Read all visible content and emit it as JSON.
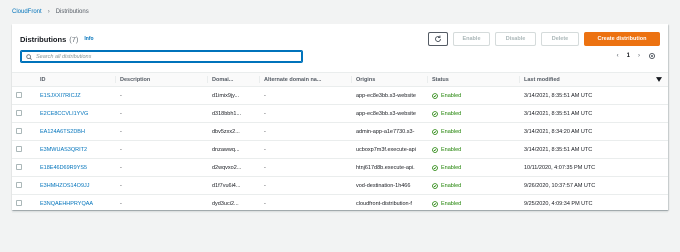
{
  "breadcrumb": {
    "parent": "CloudFront",
    "current": "Distributions"
  },
  "header": {
    "title": "Distributions",
    "count": "(7)",
    "info": "Info"
  },
  "actions": {
    "enable": "Enable",
    "disable": "Disable",
    "delete": "Delete",
    "create": "Create distribution"
  },
  "search": {
    "placeholder": "Search all distributions"
  },
  "pager": {
    "page": "1"
  },
  "columns": [
    "ID",
    "Description",
    "Domai...",
    "Alternate domain na...",
    "Origins",
    "Status",
    "Last modified"
  ],
  "rows": [
    {
      "id": "E1SJXXI7RICJZ",
      "description": "-",
      "domain": "d1imix9jy...",
      "alternate": "-",
      "origin": "app-ec8e3bb.s3-website",
      "status": "Enabled",
      "modified": "3/14/2021, 8:35:51 AM UTC"
    },
    {
      "id": "E2CE8CCVLI1YVG",
      "description": "-",
      "domain": "d318bbh1...",
      "alternate": "-",
      "origin": "app-ec8e3bb.s3-website",
      "status": "Enabled",
      "modified": "3/14/2021, 8:35:51 AM UTC"
    },
    {
      "id": "EA124A6TS2DBH",
      "description": "-",
      "domain": "dbv5zxx2...",
      "alternate": "-",
      "origin": "admin-app-a1e7730.s3-",
      "status": "Enabled",
      "modified": "3/14/2021, 8:34:20 AM UTC"
    },
    {
      "id": "E3MWUAS3QRIT2",
      "description": "-",
      "domain": "dnzawwq...",
      "alternate": "-",
      "origin": "ucboxp7m3f.execute-api",
      "status": "Enabled",
      "modified": "3/14/2021, 8:35:51 AM UTC"
    },
    {
      "id": "E18E46D69R9YS5",
      "description": "-",
      "domain": "d2wqvxo2...",
      "alternate": "-",
      "origin": "htnj617d8b.execute-api.",
      "status": "Enabled",
      "modified": "10/11/2020, 4:07:35 PM UTC"
    },
    {
      "id": "E3HMHZOS14O9JJ",
      "description": "-",
      "domain": "d1f7vu6i4...",
      "alternate": "-",
      "origin": "vod-destination-1h466",
      "status": "Enabled",
      "modified": "9/26/2020, 10:37:57 AM UTC"
    },
    {
      "id": "E3NQAEHHPRYQAA",
      "description": "-",
      "domain": "dyd3uci2...",
      "alternate": "-",
      "origin": "cloudfront-distribution-f",
      "status": "Enabled",
      "modified": "9/25/2020, 4:09:34 PM UTC"
    }
  ],
  "colors": {
    "link": "#0073bb",
    "primary": "#ec7211",
    "enabled": "#1d8102"
  }
}
